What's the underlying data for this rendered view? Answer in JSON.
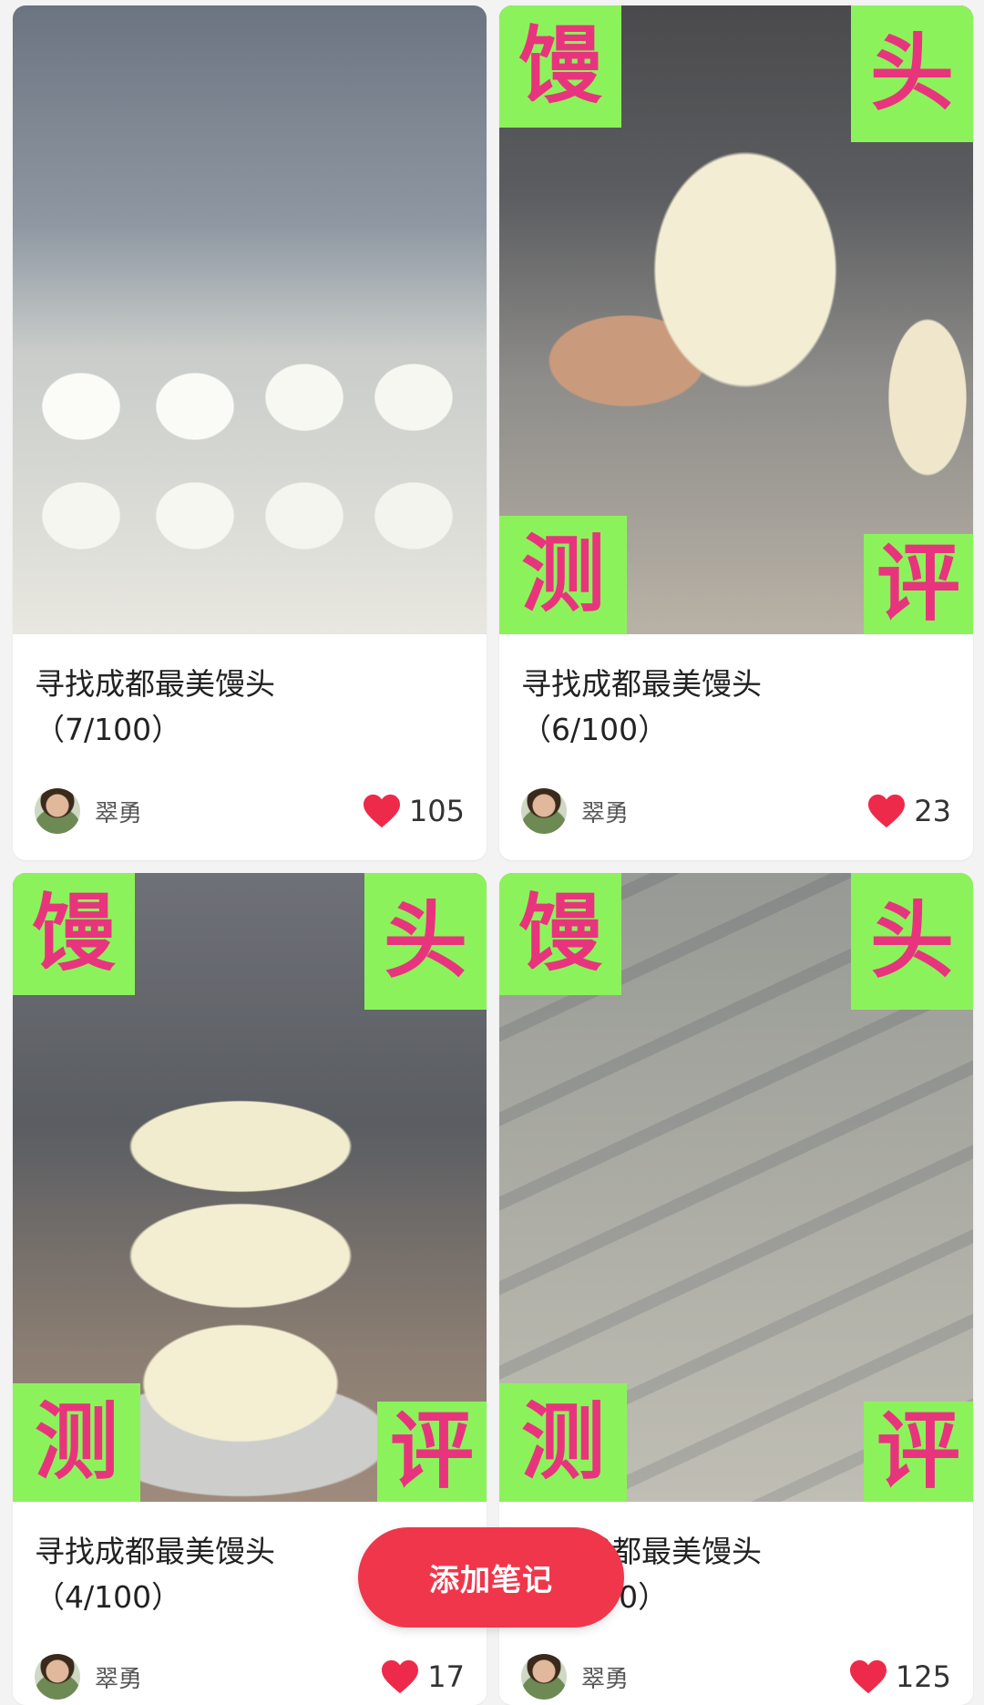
{
  "feed": {
    "cards": [
      {
        "title": "寻找成都最美馒头\n（7/100）",
        "author": "翠勇",
        "likes": "105",
        "tags": null
      },
      {
        "title": "寻找成都最美馒头\n（6/100）",
        "author": "翠勇",
        "likes": "23",
        "tags": {
          "tl": "馒",
          "tr": "头",
          "bl": "测",
          "br": "评"
        }
      },
      {
        "title": "寻找成都最美馒头\n（4/100）",
        "author": "翠勇",
        "likes": "17",
        "tags": {
          "tl": "馒",
          "tr": "头",
          "bl": "测",
          "br": "评"
        }
      },
      {
        "title": "寻找成都最美馒头\n（5/100）",
        "author": "翠勇",
        "likes": "125",
        "tags": {
          "tl": "馒",
          "tr": "头",
          "bl": "测",
          "br": "评"
        }
      }
    ]
  },
  "fab": {
    "label": "添加笔记"
  },
  "colors": {
    "tag_bg": "#8cf25c",
    "tag_text": "#e8347d",
    "fab_bg": "#f0364b",
    "heart": "#ee2a4a"
  },
  "icons": {
    "like": "heart-icon",
    "avatar": "avatar"
  }
}
